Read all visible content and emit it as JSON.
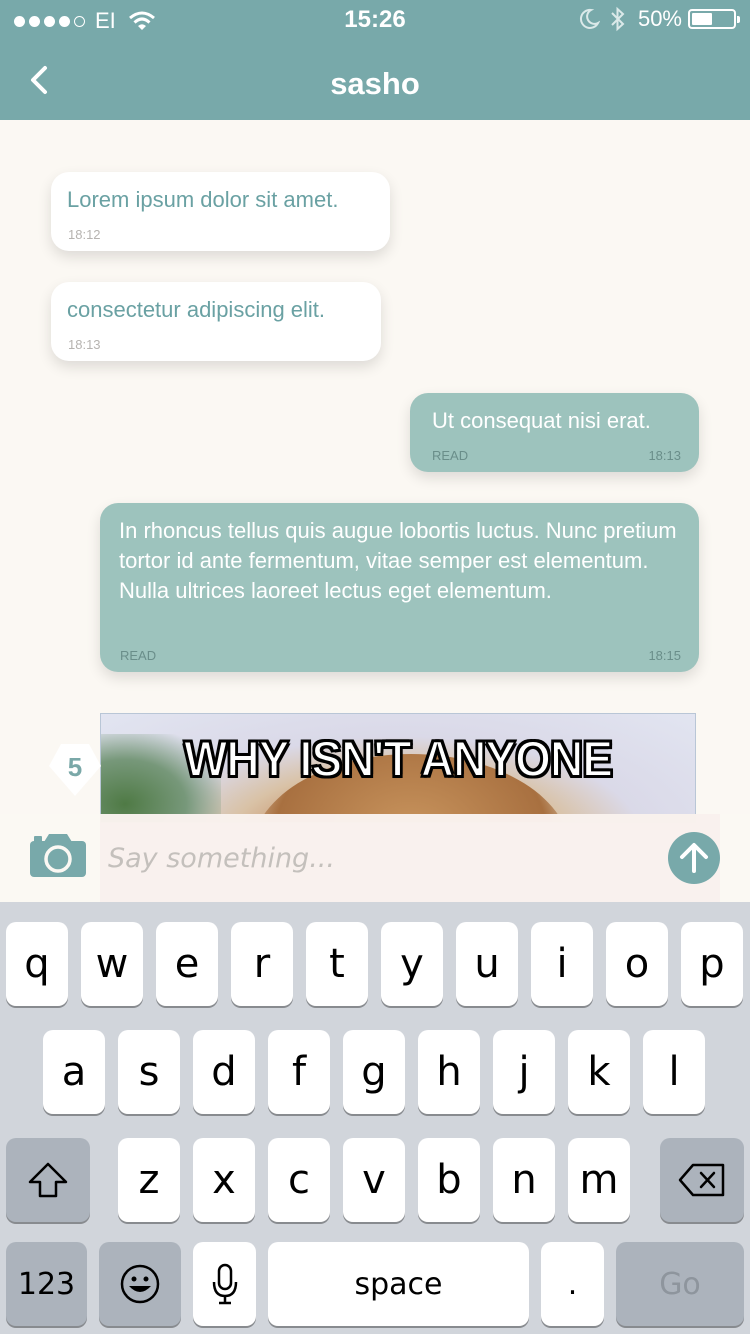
{
  "status_bar": {
    "carrier": "EI",
    "time": "15:26",
    "battery": "50%",
    "battery_level": 0.5,
    "icons": [
      "signal-dots-icon",
      "wifi-icon",
      "moon-icon",
      "bluetooth-icon",
      "battery-icon"
    ]
  },
  "header": {
    "title": "sasho",
    "back_icon": "chevron-left-icon"
  },
  "messages": [
    {
      "direction": "incoming",
      "text": "Lorem ipsum dolor sit amet.",
      "time": "18:12",
      "status": ""
    },
    {
      "direction": "incoming",
      "text": "consectetur adipiscing elit.",
      "time": "18:13",
      "status": ""
    },
    {
      "direction": "outgoing",
      "text": "Ut consequat nisi erat.",
      "time": "18:13",
      "status": "READ"
    },
    {
      "direction": "outgoing",
      "text": "In rhoncus tellus quis augue lobortis luctus. Nunc pretium tortor id ante fermentum, vitae semper est elementum. Nulla ultrices laoreet lectus eget elementum.",
      "time": "18:15",
      "status": "READ"
    }
  ],
  "image_message": {
    "caption": "WHY ISN'T ANYONE"
  },
  "badge": {
    "count": "5"
  },
  "composer": {
    "placeholder": "Say something...",
    "value": "",
    "camera_icon": "camera-icon",
    "send_icon": "arrow-up-icon"
  },
  "keyboard": {
    "row1": [
      "q",
      "w",
      "e",
      "r",
      "t",
      "y",
      "u",
      "i",
      "o",
      "p"
    ],
    "row2": [
      "a",
      "s",
      "d",
      "f",
      "g",
      "h",
      "j",
      "k",
      "l"
    ],
    "row3": [
      "z",
      "x",
      "c",
      "v",
      "b",
      "n",
      "m"
    ],
    "numbers_label": "123",
    "space_label": "space",
    "period_label": ".",
    "go_label": "Go",
    "icons": [
      "shift-icon",
      "backspace-icon",
      "emoji-icon",
      "microphone-icon"
    ]
  },
  "colors": {
    "accent": "#78a9aa",
    "outgoing_bubble": "#9dc3bd",
    "incoming_bubble": "#ffffff",
    "incoming_text": "#6aa1a3",
    "background": "#fbf8f3",
    "keyboard_bg": "#d1d5db"
  }
}
